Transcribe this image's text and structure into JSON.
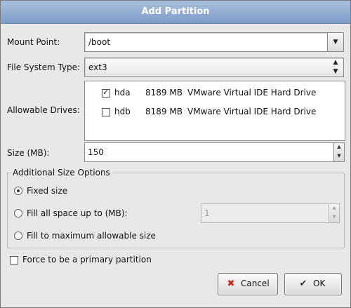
{
  "dialog": {
    "title": "Add Partition",
    "mount_point": {
      "label": "Mount Point:",
      "value": "/boot"
    },
    "fs_type": {
      "label": "File System Type:",
      "value": "ext3"
    },
    "drives": {
      "label": "Allowable Drives:",
      "rows": [
        {
          "name": "hda",
          "size": "8189 MB",
          "model": "VMware Virtual IDE Hard Drive",
          "checked": true
        },
        {
          "name": "hdb",
          "size": "8189 MB",
          "model": "VMware Virtual IDE Hard Drive",
          "checked": false
        }
      ]
    },
    "size": {
      "label": "Size (MB):",
      "value": "150"
    },
    "additional": {
      "legend": "Additional Size Options",
      "fixed": "Fixed size",
      "fill_upto": "Fill all space up to (MB):",
      "fill_upto_value": "1",
      "fill_max": "Fill to maximum allowable size",
      "selected": "fixed"
    },
    "force_primary": {
      "label": "Force to be a primary partition",
      "checked": false
    },
    "buttons": {
      "cancel": "Cancel",
      "ok": "OK"
    }
  },
  "icons": {
    "cancel": "cancel-x-icon",
    "ok": "ok-check-icon"
  },
  "colors": {
    "titlebar": "#8fa9d0",
    "dialog_bg": "#e8e8e6",
    "cancel_icon": "#cc2222"
  }
}
